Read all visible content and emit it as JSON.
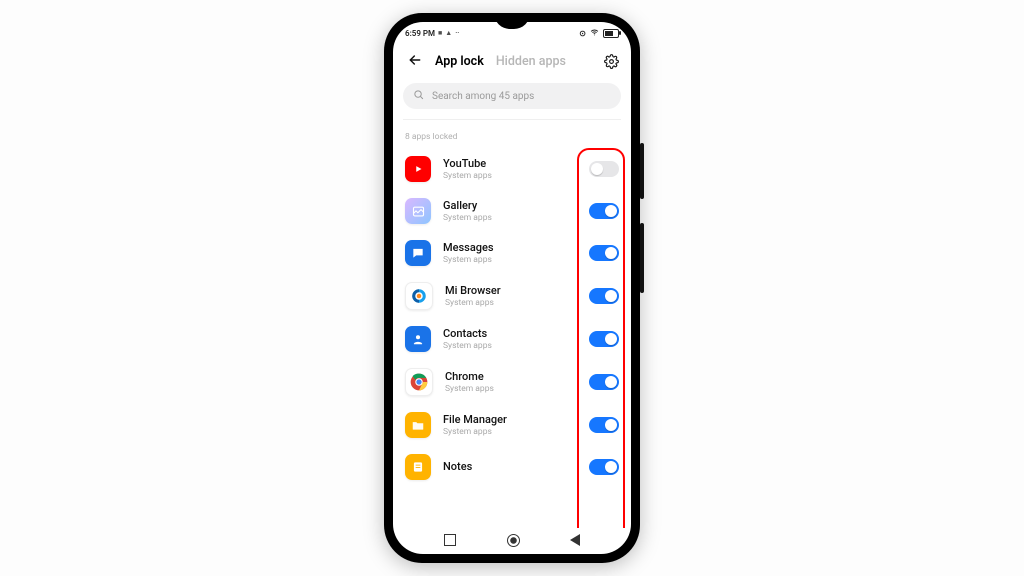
{
  "status": {
    "time": "6:59 PM"
  },
  "header": {
    "active_tab": "App lock",
    "inactive_tab": "Hidden apps"
  },
  "search": {
    "placeholder": "Search among 45 apps"
  },
  "section": {
    "locked_caption": "8 apps locked"
  },
  "apps": [
    {
      "name": "YouTube",
      "sub": "System apps",
      "icon": "youtube",
      "locked": false
    },
    {
      "name": "Gallery",
      "sub": "System apps",
      "icon": "gallery",
      "locked": true
    },
    {
      "name": "Messages",
      "sub": "System apps",
      "icon": "messages",
      "locked": true
    },
    {
      "name": "Mi Browser",
      "sub": "System apps",
      "icon": "browser",
      "locked": true
    },
    {
      "name": "Contacts",
      "sub": "System apps",
      "icon": "contacts",
      "locked": true
    },
    {
      "name": "Chrome",
      "sub": "System apps",
      "icon": "chrome",
      "locked": true
    },
    {
      "name": "File Manager",
      "sub": "System apps",
      "icon": "filemgr",
      "locked": true
    },
    {
      "name": "Notes",
      "sub": "",
      "icon": "notes",
      "locked": true
    }
  ],
  "colors": {
    "toggle_on": "#1677ff",
    "toggle_off": "#e6e6e8",
    "callout": "#ff0000"
  }
}
